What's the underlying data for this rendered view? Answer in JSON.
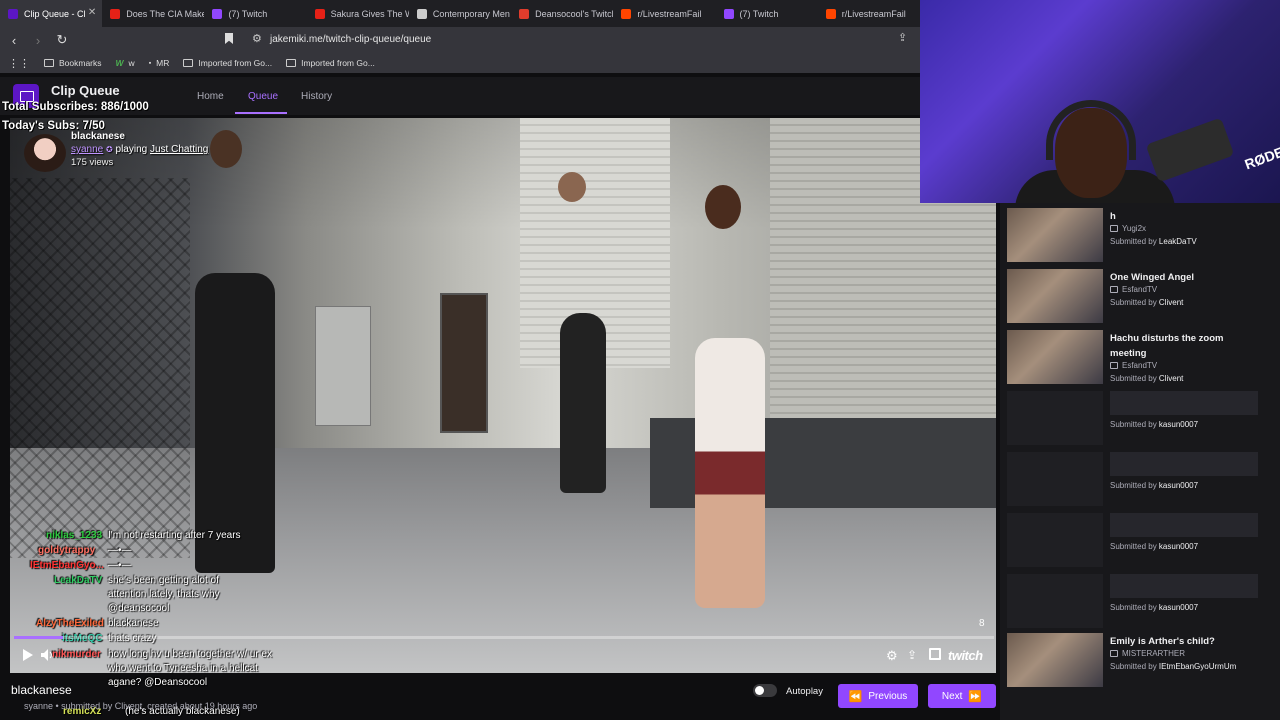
{
  "browser": {
    "tabs": [
      {
        "label": "Clip Queue - Cl",
        "color": "#5c16c5",
        "active": true
      },
      {
        "label": "Does The CIA Make",
        "color": "#e62117",
        "active": false
      },
      {
        "label": "(7) Twitch",
        "color": "#9147ff",
        "active": false
      },
      {
        "label": "Sakura Gives The W",
        "color": "#e62117",
        "active": false
      },
      {
        "label": "Contemporary Men",
        "color": "#cccccc",
        "active": false
      },
      {
        "label": "Deansocool's Twitch",
        "color": "#e03c2c",
        "active": false
      },
      {
        "label": "r/LivestreamFail",
        "color": "#ff4500",
        "active": false
      },
      {
        "label": "(7) Twitch",
        "color": "#9147ff",
        "active": false
      },
      {
        "label": "r/LivestreamFail",
        "color": "#ff4500",
        "active": false
      }
    ],
    "url": "jakemiki.me/twitch-clip-queue/queue",
    "bookmarks": [
      "Bookmarks",
      "w",
      "MR",
      "Imported from Go...",
      "Imported from Go..."
    ]
  },
  "app": {
    "title": "Clip Queue",
    "nav": [
      "Home",
      "Queue",
      "History"
    ],
    "subs_total": "Total Subscribes: 886/1000",
    "subs_today": "Today's Subs: 7/50"
  },
  "clip": {
    "title": "blackanese",
    "broadcaster": "syanne",
    "playing": "playing",
    "category": "Just Chatting",
    "views": "175 views",
    "count": "8",
    "progress": 0.05,
    "below_title": "blackanese",
    "below_meta": "syanne • submitted by Clivent, created about 19 hours ago"
  },
  "chat": [
    {
      "name": "niklas_1233",
      "color": "#2ecc40",
      "text": "I'm not restarting after 7 years"
    },
    {
      "name": "goldytrappy",
      "color": "#ff6f61",
      "text": "—•—"
    },
    {
      "name": "IEtmEbanGyo...",
      "color": "#ff3333",
      "text": "—•—"
    },
    {
      "name": "LeakDaTV",
      "color": "#33cc66",
      "text": "she's been getting alot of attention lately, thats why @deansocool"
    },
    {
      "name": "AlzyTheExiled",
      "color": "#ff6a3d",
      "text": "blackanese"
    },
    {
      "name": "itsMeQC",
      "color": "#33ccaa",
      "text": "thats crazy"
    },
    {
      "name": "nikmurder",
      "color": "#ff5555",
      "text": "how long hv u been together w/ ur ex who went to Tyneesha in a hellcat agane? @Deansocool"
    },
    {
      "name": "remicXz",
      "color": "#d4e157",
      "text": "(he's actually blackanese)"
    }
  ],
  "controls": {
    "autoplay_label": "Autoplay",
    "previous_label": "Previous",
    "next_label": "Next",
    "twitch": "twitch"
  },
  "queue": [
    {
      "title": "h",
      "channel": "Yugi2x",
      "submitted_prefix": "Submitted by ",
      "submitter": "LeakDaTV",
      "has_thumb": true
    },
    {
      "title": "One Winged Angel",
      "channel": "EsfandTV",
      "submitted_prefix": "Submitted by ",
      "submitter": "Clivent",
      "has_thumb": true
    },
    {
      "title": "Hachu disturbs the zoom meeting",
      "channel": "EsfandTV",
      "submitted_prefix": "Submitted by ",
      "submitter": "Clivent",
      "has_thumb": true
    },
    {
      "title": "",
      "channel": "",
      "submitted_prefix": "Submitted by ",
      "submitter": "kasun0007",
      "has_thumb": false
    },
    {
      "title": "",
      "channel": "",
      "submitted_prefix": "Submitted by ",
      "submitter": "kasun0007",
      "has_thumb": false
    },
    {
      "title": "",
      "channel": "",
      "submitted_prefix": "Submitted by ",
      "submitter": "kasun0007",
      "has_thumb": false
    },
    {
      "title": "",
      "channel": "",
      "submitted_prefix": "Submitted by ",
      "submitter": "kasun0007",
      "has_thumb": false
    },
    {
      "title": "Emily is Arther's child?",
      "channel": "MISTERARTHER",
      "submitted_prefix": "Submitted by ",
      "submitter": "IEtmEbanGyoUrmUm",
      "has_thumb": true
    }
  ],
  "webcam": {
    "mic_label": "RØDE"
  },
  "colors": {
    "accent": "#9147ff",
    "accent_light": "#a970ff",
    "background": "#0e0e10"
  }
}
